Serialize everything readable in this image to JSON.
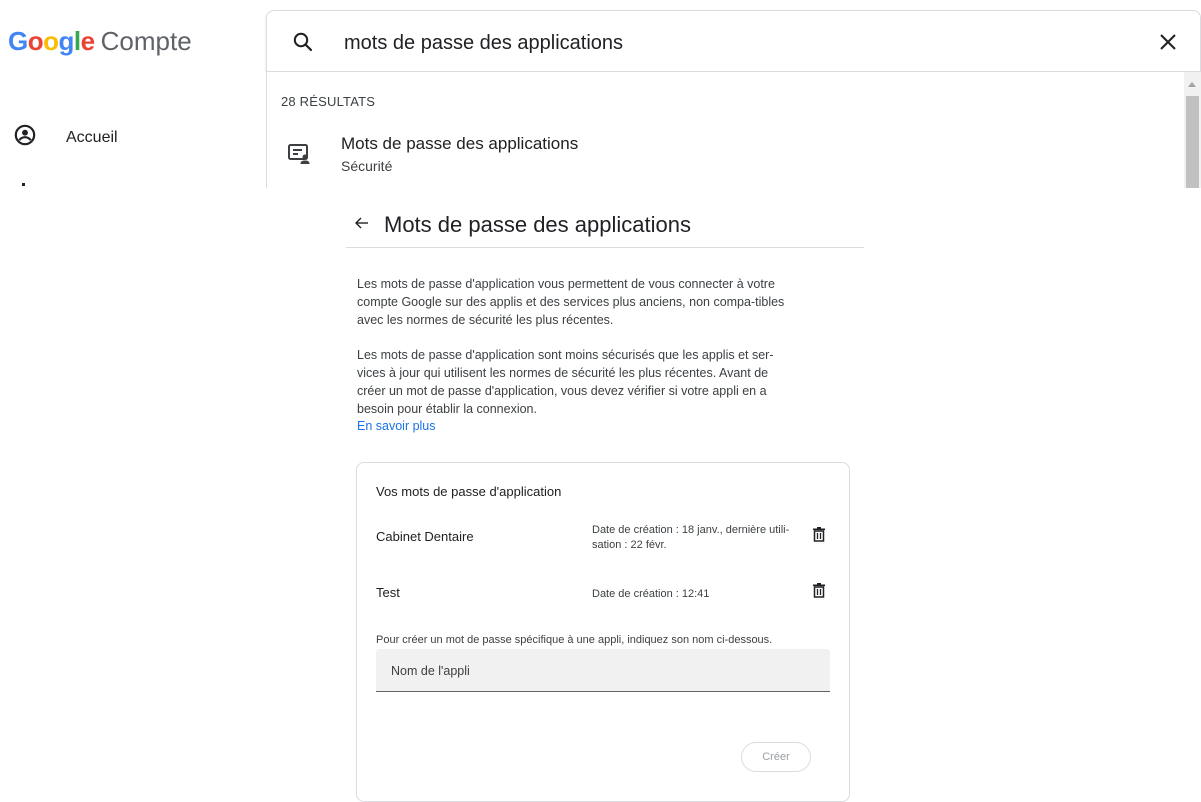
{
  "brand": {
    "letters": [
      "G",
      "o",
      "o",
      "g",
      "l",
      "e"
    ],
    "product": "Compte"
  },
  "nav": {
    "items": [
      {
        "label": "Accueil",
        "icon": "account-circle-icon"
      }
    ]
  },
  "search": {
    "value": "mots de passe des applications",
    "icon": "search-icon",
    "close_icon": "close-icon"
  },
  "results": {
    "count": "28 RÉSULTATS",
    "items": [
      {
        "title": "Mots de passe des applications",
        "subtitle": "Sécurité",
        "icon": "password-manager-icon"
      }
    ]
  },
  "page": {
    "title": "Mots de passe des applications",
    "back_icon": "arrow-back-icon",
    "paragraph1": "Les mots de passe d'application vous permettent de vous connecter à votre compte Google sur des applis et des services plus anciens, non compa-tibles avec les normes de sécurité les plus récentes.",
    "paragraph2": "Les mots de passe d'application sont moins sécurisés que les applis et ser-vices à jour qui utilisent les normes de sécurité les plus récentes. Avant de créer un mot de passe d'application, vous devez vérifier si votre appli en a besoin pour établir la connexion.",
    "learn_more": "En savoir plus"
  },
  "card": {
    "title": "Vos mots de passe d'application",
    "passwords": [
      {
        "name": "Cabinet Dentaire",
        "meta": "Date de création  : 18 janv., dernière utili-sation : 22 févr."
      },
      {
        "name": "Test",
        "meta": "Date de création : 12:41"
      }
    ],
    "hint": "Pour créer un mot de passe spécifique à une appli, indiquez son nom ci-dessous.",
    "input_placeholder": "Nom de l'appli",
    "create_label": "Créer"
  },
  "colors": {
    "google_blue": "#4285F4",
    "google_red": "#EA4335",
    "google_yellow": "#FBBC05",
    "google_green": "#34A853",
    "link": "#1a73e8"
  }
}
